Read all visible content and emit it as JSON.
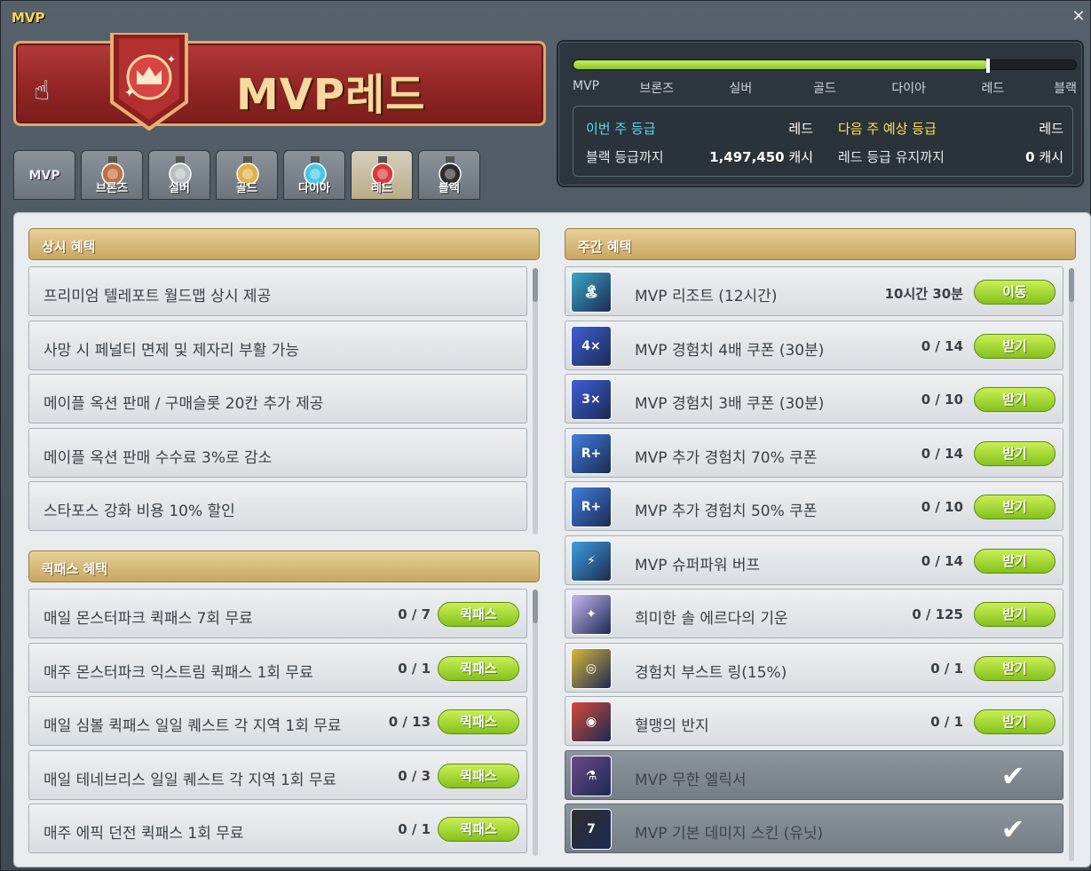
{
  "window": {
    "title": "MVP",
    "close_glyph": "×"
  },
  "banner": {
    "title": "MVP레드",
    "hand_icon": "pointer-hand-icon",
    "badge_icon": "red-crown-medal-icon"
  },
  "tabs": [
    {
      "label": "MVP",
      "icon": ""
    },
    {
      "label": "브론즈",
      "icon": "bronze-medal-icon",
      "color": "#c07046"
    },
    {
      "label": "실버",
      "icon": "silver-medal-icon",
      "color": "#b8bec4"
    },
    {
      "label": "골드",
      "icon": "gold-medal-icon",
      "color": "#e1b24a"
    },
    {
      "label": "다이아",
      "icon": "diamond-medal-icon",
      "color": "#46c8e6"
    },
    {
      "label": "레드",
      "icon": "red-medal-icon",
      "color": "#d83a3a",
      "active": true
    },
    {
      "label": "블랙",
      "icon": "black-medal-icon",
      "color": "#2e2e2e"
    }
  ],
  "progress": {
    "fraction": 0.825,
    "grades": [
      "MVP",
      "브론즈",
      "실버",
      "골드",
      "다이아",
      "레드",
      "블랙"
    ],
    "this_week_label": "이번 주 등급",
    "this_week_value": "레드",
    "next_week_label": "다음 주 예상 등급",
    "next_week_value": "레드",
    "to_black_label": "블랙 등급까지",
    "to_black_value": "1,497,450",
    "to_black_unit": "캐시",
    "keep_red_label": "레드 등급 유지까지",
    "keep_red_value": "0",
    "keep_red_unit": "캐시"
  },
  "permanent": {
    "header": "상시 혜택",
    "items": [
      "프리미엄 텔레포트 월드맵 상시 제공",
      "사망 시 페널티 면제 및 제자리 부활 가능",
      "메이플 옥션 판매 / 구매슬롯 20칸 추가 제공",
      "메이플 옥션 판매 수수료 3%로 감소",
      "스타포스 강화 비용 10% 할인"
    ]
  },
  "quickpass": {
    "header": "퀵패스 혜택",
    "button_label": "퀵패스",
    "items": [
      {
        "label": "매일 몬스터파크 퀵패스 7회 무료",
        "count": "0 / 7"
      },
      {
        "label": "매주 몬스터파크 익스트림 퀵패스 1회 무료",
        "count": "0 / 1"
      },
      {
        "label": "매일 심볼 퀵패스 일일 퀘스트 각 지역 1회 무료",
        "count": "0 / 13"
      },
      {
        "label": "매일 테네브리스 일일 퀘스트 각 지역 1회 무료",
        "count": "0 / 3"
      },
      {
        "label": "매주 에픽 던전 퀵패스 1회 무료",
        "count": "0 / 1"
      }
    ]
  },
  "weekly": {
    "header": "주간 혜택",
    "items": [
      {
        "label": "MVP 리조트 (12시간)",
        "count": "10시간 30분",
        "button": "이동",
        "icon": "resort-icon",
        "done": false
      },
      {
        "label": "MVP 경험치 4배 쿠폰 (30분)",
        "count": "0 / 14",
        "button": "받기",
        "icon": "exp-4x-coupon-icon",
        "done": false
      },
      {
        "label": "MVP 경험치 3배 쿠폰 (30분)",
        "count": "0 / 10",
        "button": "받기",
        "icon": "exp-3x-coupon-icon",
        "done": false
      },
      {
        "label": "MVP 추가 경험치 70% 쿠폰",
        "count": "0 / 14",
        "button": "받기",
        "icon": "bonus-exp-70-coupon-icon",
        "done": false
      },
      {
        "label": "MVP 추가 경험치 50% 쿠폰",
        "count": "0 / 10",
        "button": "받기",
        "icon": "bonus-exp-50-coupon-icon",
        "done": false
      },
      {
        "label": "MVP 슈퍼파워 버프",
        "count": "0 / 14",
        "button": "받기",
        "icon": "superpower-buff-icon",
        "done": false
      },
      {
        "label": "희미한 솔 에르다의 기운",
        "count": "0 / 125",
        "button": "받기",
        "icon": "sol-erda-orb-icon",
        "done": false
      },
      {
        "label": "경험치 부스트 링(15%)",
        "count": "0 / 1",
        "button": "받기",
        "icon": "exp-boost-ring-icon",
        "done": false
      },
      {
        "label": "혈맹의 반지",
        "count": "0 / 1",
        "button": "받기",
        "icon": "blood-oath-ring-icon",
        "done": false
      },
      {
        "label": "MVP 무한 엘릭서",
        "count": "",
        "button": "",
        "icon": "infinite-elixir-icon",
        "done": true
      },
      {
        "label": "MVP 기본 데미지 스킨 (유닛)",
        "count": "",
        "button": "",
        "icon": "damage-skin-icon",
        "done": true
      }
    ]
  }
}
